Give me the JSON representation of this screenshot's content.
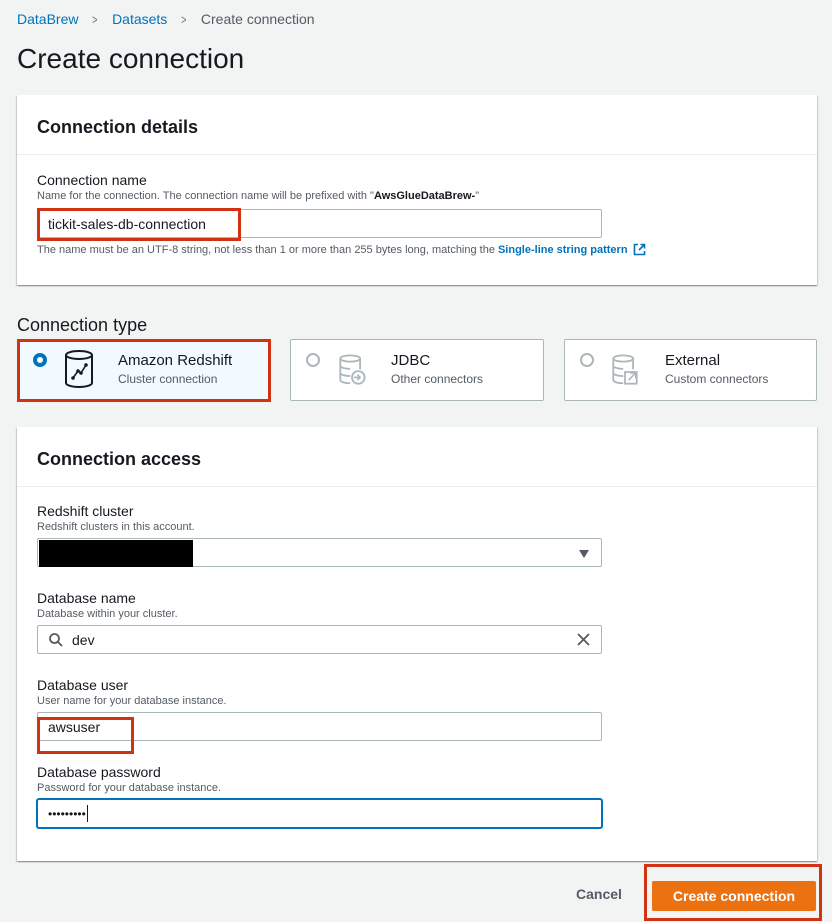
{
  "breadcrumb": {
    "items": [
      "DataBrew",
      "Datasets",
      "Create connection"
    ]
  },
  "page_title": "Create connection",
  "connection_details": {
    "header": "Connection details",
    "name_label": "Connection name",
    "name_desc_prefix": "Name for the connection. The connection name will be prefixed with \"",
    "name_desc_prefix_value": "AwsGlueDataBrew-",
    "name_desc_suffix": "\"",
    "name_value": "tickit-sales-db-connection",
    "constraint_text": "The name must be an UTF-8 string, not less than 1 or more than 255 bytes long, matching the",
    "constraint_link": "Single-line string pattern"
  },
  "connection_type": {
    "label": "Connection type",
    "options": [
      {
        "title": "Amazon Redshift",
        "subtitle": "Cluster connection",
        "selected": true,
        "icon": "redshift-icon"
      },
      {
        "title": "JDBC",
        "subtitle": "Other connectors",
        "selected": false,
        "icon": "jdbc-database-icon"
      },
      {
        "title": "External",
        "subtitle": "Custom connectors",
        "selected": false,
        "icon": "external-database-icon"
      }
    ]
  },
  "connection_access": {
    "header": "Connection access",
    "cluster_label": "Redshift cluster",
    "cluster_desc": "Redshift clusters in this account.",
    "db_name_label": "Database name",
    "db_name_desc": "Database within your cluster.",
    "db_name_value": "dev",
    "db_user_label": "Database user",
    "db_user_desc": "User name for your database instance.",
    "db_user_value": "awsuser",
    "db_password_label": "Database password",
    "db_password_desc": "Password for your database instance.",
    "db_password_value": "•••••••••"
  },
  "footer": {
    "cancel_label": "Cancel",
    "create_label": "Create connection"
  },
  "colors": {
    "primary": "#ec7211",
    "link": "#0073bb",
    "highlight": "#d13212"
  }
}
